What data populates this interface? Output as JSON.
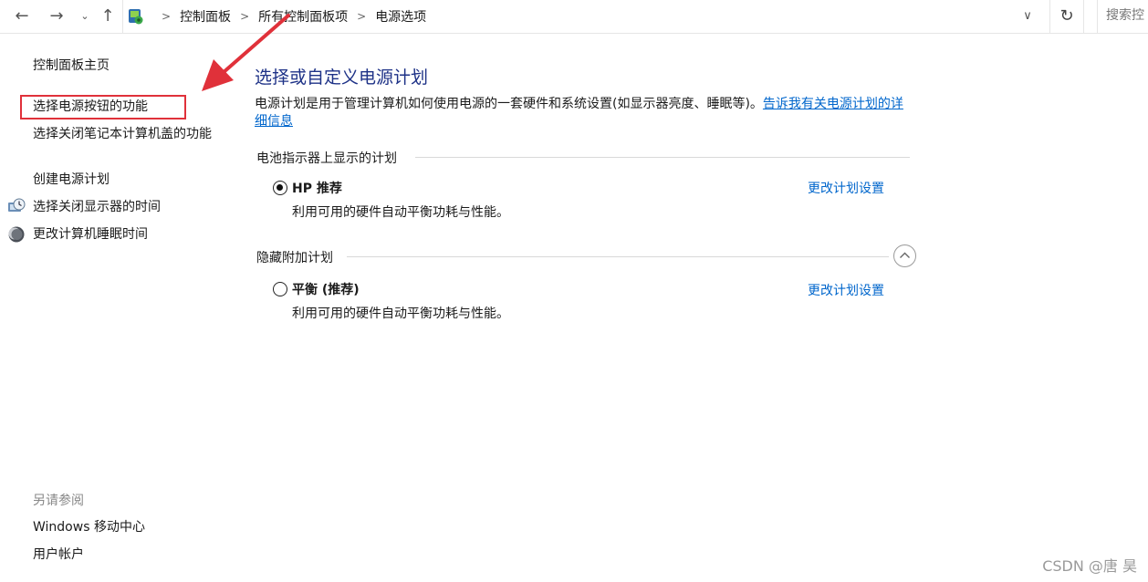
{
  "address_bar": {
    "breadcrumbs": [
      "控制面板",
      "所有控制面板项",
      "电源选项"
    ],
    "search_placeholder": "搜索控"
  },
  "left_pane": {
    "home": "控制面板主页",
    "links": {
      "power_button": "选择电源按钮的功能",
      "lid": "选择关闭笔记本计算机盖的功能",
      "create_plan": "创建电源计划",
      "display_off": "选择关闭显示器的时间",
      "sleep": "更改计算机睡眠时间"
    },
    "see_also": {
      "title": "另请参阅",
      "mobility_center": "Windows 移动中心",
      "user_accounts": "用户帐户"
    }
  },
  "main": {
    "title": "选择或自定义电源计划",
    "description": "电源计划是用于管理计算机如何使用电源的一套硬件和系统设置(如显示器亮度、睡眠等)。",
    "description_link": "告诉我有关电源计划的详细信息",
    "battery_section": "电池指示器上显示的计划",
    "hidden_section": "隐藏附加计划",
    "plans": [
      {
        "name": "HP 推荐",
        "description": "利用可用的硬件自动平衡功耗与性能。",
        "change_link": "更改计划设置",
        "selected": true
      },
      {
        "name": "平衡 (推荐)",
        "description": "利用可用的硬件自动平衡功耗与性能。",
        "change_link": "更改计划设置",
        "selected": false
      }
    ]
  },
  "annotation": {
    "color": "#e0313a"
  },
  "watermark": "CSDN @唐 昊"
}
